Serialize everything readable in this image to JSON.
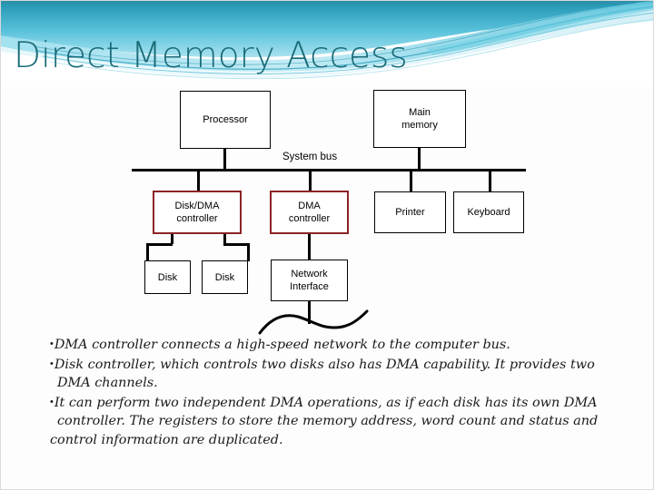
{
  "slide": {
    "title": "Direct Memory Access",
    "title_color": "#1a6b78",
    "background_color": "#fdfdfd",
    "accent_border_color": "#8c2326",
    "line_color": "#000000",
    "header_colors": {
      "teal_dark": "#1f9bb5",
      "teal_mid": "#6fcfe0",
      "teal_light": "#b8e7f0",
      "sky": "#5bc6de",
      "white": "#ffffff"
    }
  },
  "diagram": {
    "bus_label": "System bus",
    "boxes": [
      {
        "id": "processor",
        "label": "Processor",
        "accent": false
      },
      {
        "id": "main-memory",
        "label": "Main\nmemory",
        "accent": false
      },
      {
        "id": "disk-dma-controller",
        "label": "Disk/DMA\ncontroller",
        "accent": true
      },
      {
        "id": "dma-controller",
        "label": "DMA\ncontroller",
        "accent": true
      },
      {
        "id": "printer",
        "label": "Printer",
        "accent": false
      },
      {
        "id": "keyboard",
        "label": "Keyboard",
        "accent": false
      },
      {
        "id": "disk-1",
        "label": "Disk",
        "accent": false
      },
      {
        "id": "disk-2",
        "label": "Disk",
        "accent": false
      },
      {
        "id": "network-interface",
        "label": "Network\nInterface",
        "accent": false
      }
    ],
    "labels": {
      "processor": "Processor",
      "main_memory_line1": "Main",
      "main_memory_line2": "memory",
      "disk_dma_line1": "Disk/DMA",
      "disk_dma_line2": "controller",
      "dma_line1": "DMA",
      "dma_line2": "controller",
      "printer": "Printer",
      "keyboard": "Keyboard",
      "disk_1": "Disk",
      "disk_2": "Disk",
      "network_line1": "Network",
      "network_line2": "Interface"
    }
  },
  "body": {
    "bullets": [
      {
        "lines": [
          {
            "bullet": true,
            "text": "DMA controller connects a high-speed network to the computer bus."
          }
        ]
      },
      {
        "lines": [
          {
            "bullet": true,
            "text": "Disk controller, which controls two disks also has DMA capability. It provides two"
          },
          {
            "bullet": false,
            "text": "DMA channels."
          }
        ]
      },
      {
        "lines": [
          {
            "bullet": true,
            "text": "It can perform two independent DMA operations, as if each disk has its own DMA"
          },
          {
            "bullet": false,
            "text": "controller. The registers to store the memory address, word count and status and"
          },
          {
            "bullet": false,
            "text": "control information are duplicated.",
            "noindent": true
          }
        ]
      }
    ],
    "bullet_glyph": "•"
  }
}
